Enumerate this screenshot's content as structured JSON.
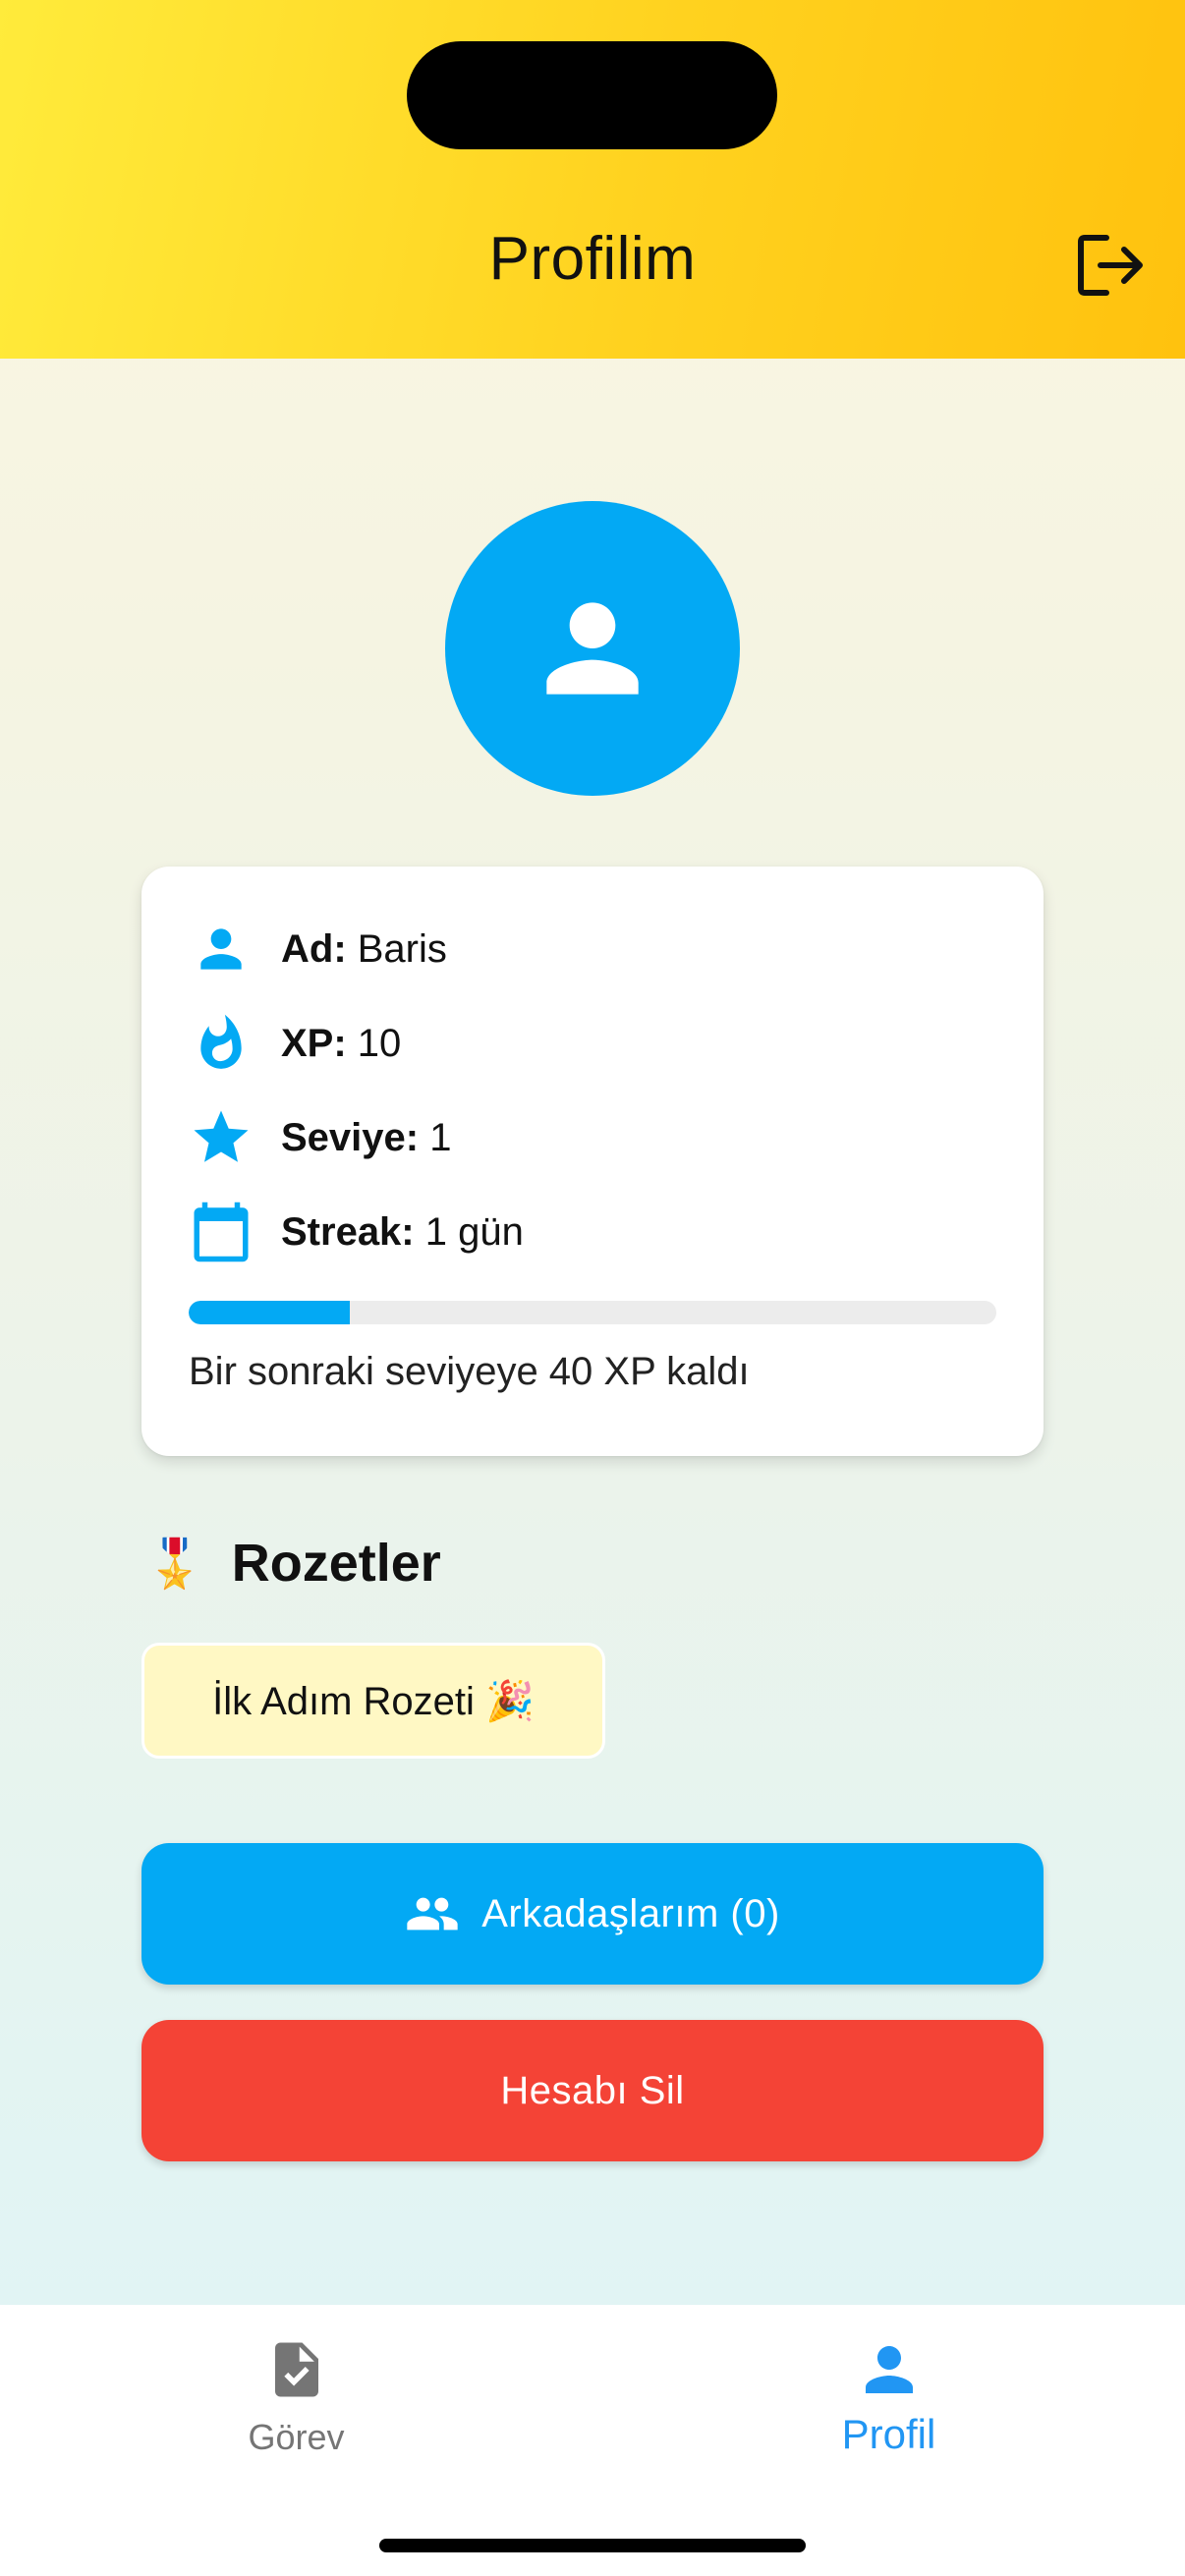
{
  "appbar": {
    "title": "Profilim",
    "logout_icon": "logout-icon"
  },
  "avatar": {
    "icon": "person-icon",
    "color": "#03a9f4"
  },
  "profile": {
    "name_label": "Ad:",
    "name_value": " Baris",
    "xp_label": "XP:",
    "xp_value": " 10",
    "level_label": "Seviye:",
    "level_value": " 1",
    "streak_label": "Streak:",
    "streak_value": " 1 gün",
    "progress_fraction": 0.2,
    "progress_text": "Bir sonraki seviyeye 40 XP kaldı"
  },
  "badges": {
    "title": "Rozetler",
    "medal": "🎖️",
    "items": [
      "İlk Adım Rozeti 🎉"
    ]
  },
  "buttons": {
    "friends_label": "Arkadaşlarım (0)",
    "delete_label": "Hesabı Sil"
  },
  "bottom_nav": {
    "items": [
      {
        "label": "Görev",
        "icon": "task-icon",
        "active": false
      },
      {
        "label": "Profil",
        "icon": "person-icon",
        "active": true
      }
    ]
  },
  "colors": {
    "accent": "#03a9f4",
    "danger": "#f44336",
    "header": "#ffd21f",
    "nav_active": "#2196f3"
  }
}
